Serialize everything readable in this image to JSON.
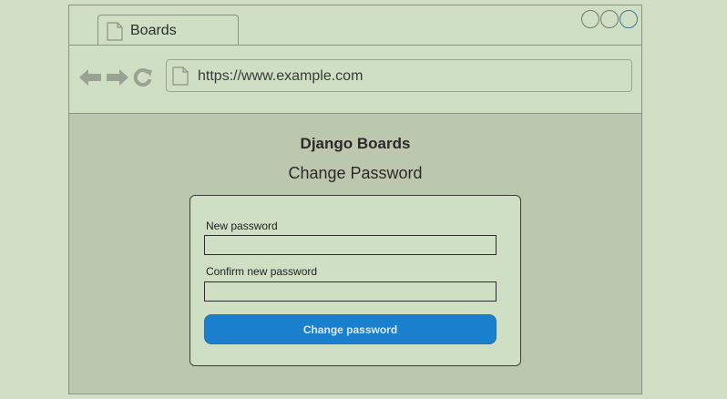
{
  "browser": {
    "tab_title": "Boards",
    "url": "https://www.example.com",
    "icons": [
      "document-icon",
      "back-arrow-icon",
      "forward-arrow-icon",
      "reload-icon"
    ]
  },
  "page": {
    "brand": "Django Boards",
    "title": "Change Password"
  },
  "form": {
    "new_password_label": "New password",
    "new_password_value": "",
    "confirm_label": "Confirm new password",
    "confirm_value": "",
    "submit_label": "Change password"
  },
  "colors": {
    "background": "#d0dfc5",
    "content_background": "#bcc8ae",
    "button": "#1a7fcc"
  }
}
